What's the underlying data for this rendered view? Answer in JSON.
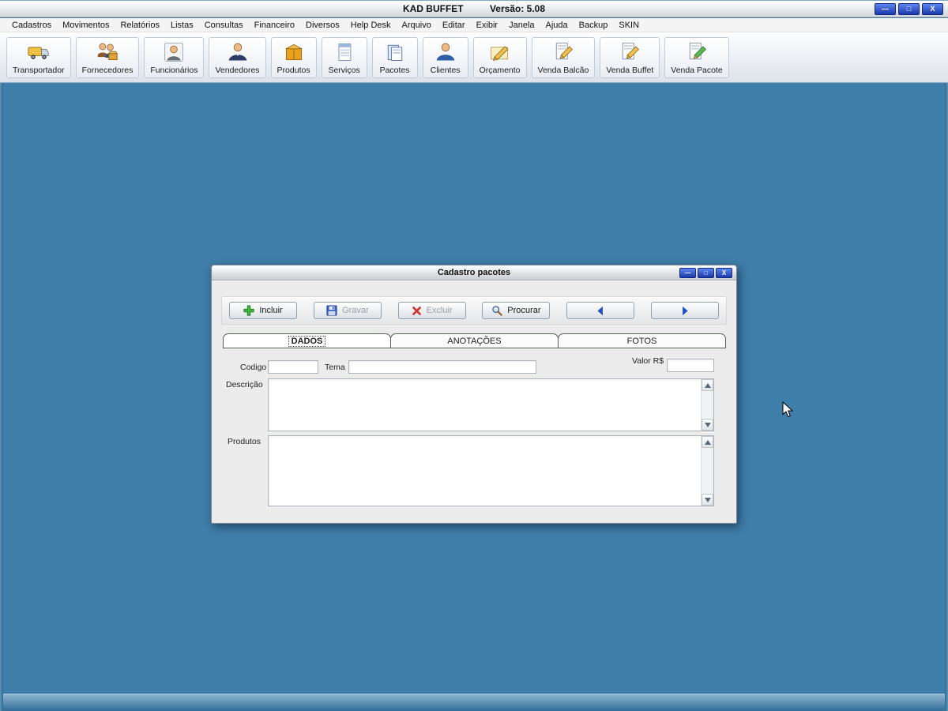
{
  "window": {
    "title": "KAD BUFFET",
    "version": "Versão: 5.08",
    "controls": {
      "minimize": "—",
      "maximize": "□",
      "close": "X"
    }
  },
  "menu": {
    "items": [
      "Cadastros",
      "Movimentos",
      "Relatórios",
      "Listas",
      "Consultas",
      "Financeiro",
      "Diversos",
      "Help Desk",
      "Arquivo",
      "Editar",
      "Exibir",
      "Janela",
      "Ajuda",
      "Backup",
      "SKIN"
    ]
  },
  "toolbar": {
    "buttons": [
      {
        "label": "Transportador",
        "icon": "truck-icon"
      },
      {
        "label": "Fornecedores",
        "icon": "suppliers-icon"
      },
      {
        "label": "Funcionários",
        "icon": "employees-icon"
      },
      {
        "label": "Vendedores",
        "icon": "salespeople-icon"
      },
      {
        "label": "Produtos",
        "icon": "products-icon"
      },
      {
        "label": "Serviços",
        "icon": "services-icon"
      },
      {
        "label": "Pacotes",
        "icon": "packages-icon"
      },
      {
        "label": "Clientes",
        "icon": "clients-icon"
      },
      {
        "label": "Orçamento",
        "icon": "estimate-icon"
      },
      {
        "label": "Venda Balcão",
        "icon": "counter-sale-icon"
      },
      {
        "label": "Venda Buffet",
        "icon": "buffet-sale-icon"
      },
      {
        "label": "Venda Pacote",
        "icon": "package-sale-icon"
      }
    ]
  },
  "dialog": {
    "title": "Cadastro pacotes",
    "controls": {
      "minimize": "—",
      "maximize": "□",
      "close": "X"
    },
    "toolbar": {
      "incluir": "Incluir",
      "gravar": "Gravar",
      "excluir": "Excluir",
      "procurar": "Procurar"
    },
    "tabs": [
      {
        "label": "DADOS",
        "active": true
      },
      {
        "label": "ANOTAÇÕES",
        "active": false
      },
      {
        "label": "FOTOS",
        "active": false
      }
    ],
    "fields": {
      "codigo_label": "Codigo",
      "codigo_value": "",
      "tema_label": "Tema",
      "tema_value": "",
      "valor_label": "Valor R$",
      "valor_value": "",
      "descricao_label": "Descrição",
      "descricao_value": "",
      "produtos_label": "Produtos",
      "produtos_value": ""
    }
  }
}
